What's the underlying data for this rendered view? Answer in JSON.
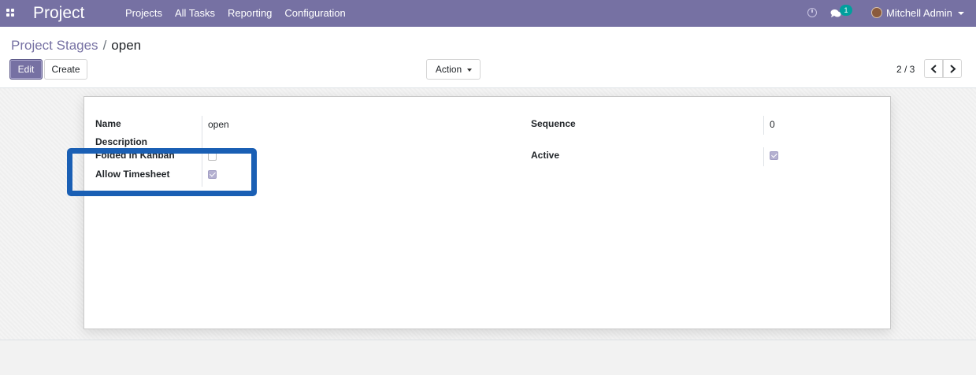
{
  "navbar": {
    "app_title": "Project",
    "menu": [
      "Projects",
      "All Tasks",
      "Reporting",
      "Configuration"
    ],
    "notification_count": "1",
    "user_name": "Mitchell Admin",
    "icons": [
      "apps-grid-icon",
      "clock-icon",
      "chat-icon",
      "avatar",
      "caret-down-icon"
    ]
  },
  "breadcrumb": {
    "parent": "Project Stages",
    "separator": "/",
    "current": "open"
  },
  "buttons": {
    "edit": "Edit",
    "create": "Create",
    "action": "Action"
  },
  "pager": {
    "value": "2 / 3"
  },
  "form": {
    "name_label": "Name",
    "name_value": "open",
    "description_label": "Description",
    "folded_label": "Folded in Kanban",
    "folded_value": false,
    "timesheet_label": "Allow Timesheet",
    "timesheet_value": true,
    "sequence_label": "Sequence",
    "sequence_value": "0",
    "active_label": "Active",
    "active_value": true
  },
  "colors": {
    "brand": "#7671a3",
    "highlight": "#1a5fb4",
    "badge": "#00a09d"
  }
}
